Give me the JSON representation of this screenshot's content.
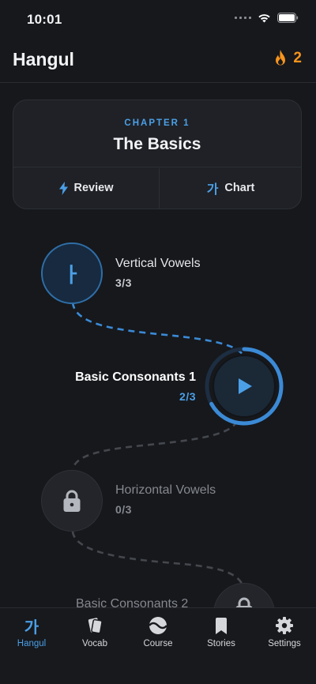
{
  "status": {
    "time": "10:01"
  },
  "header": {
    "title": "Hangul",
    "streak": "2"
  },
  "chapter": {
    "label": "CHAPTER 1",
    "title": "The Basics",
    "review_label": "Review",
    "chart_glyph": "가",
    "chart_label": "Chart"
  },
  "lessons": [
    {
      "title": "Vertical Vowels",
      "progress": "3/3",
      "glyph": "ㅏ",
      "state": "completed"
    },
    {
      "title": "Basic Consonants 1",
      "progress": "2/3",
      "state": "current",
      "completion": 0.67
    },
    {
      "title": "Horizontal Vowels",
      "progress": "0/3",
      "state": "locked"
    },
    {
      "title": "Basic Consonants 2",
      "state": "locked"
    }
  ],
  "tabs": [
    {
      "label": "Hangul",
      "glyph": "가",
      "active": true
    },
    {
      "label": "Vocab"
    },
    {
      "label": "Course"
    },
    {
      "label": "Stories"
    },
    {
      "label": "Settings"
    }
  ],
  "colors": {
    "accent": "#4b9fe6",
    "streak": "#f7941d",
    "background": "#16181c",
    "card": "#1f2126"
  }
}
